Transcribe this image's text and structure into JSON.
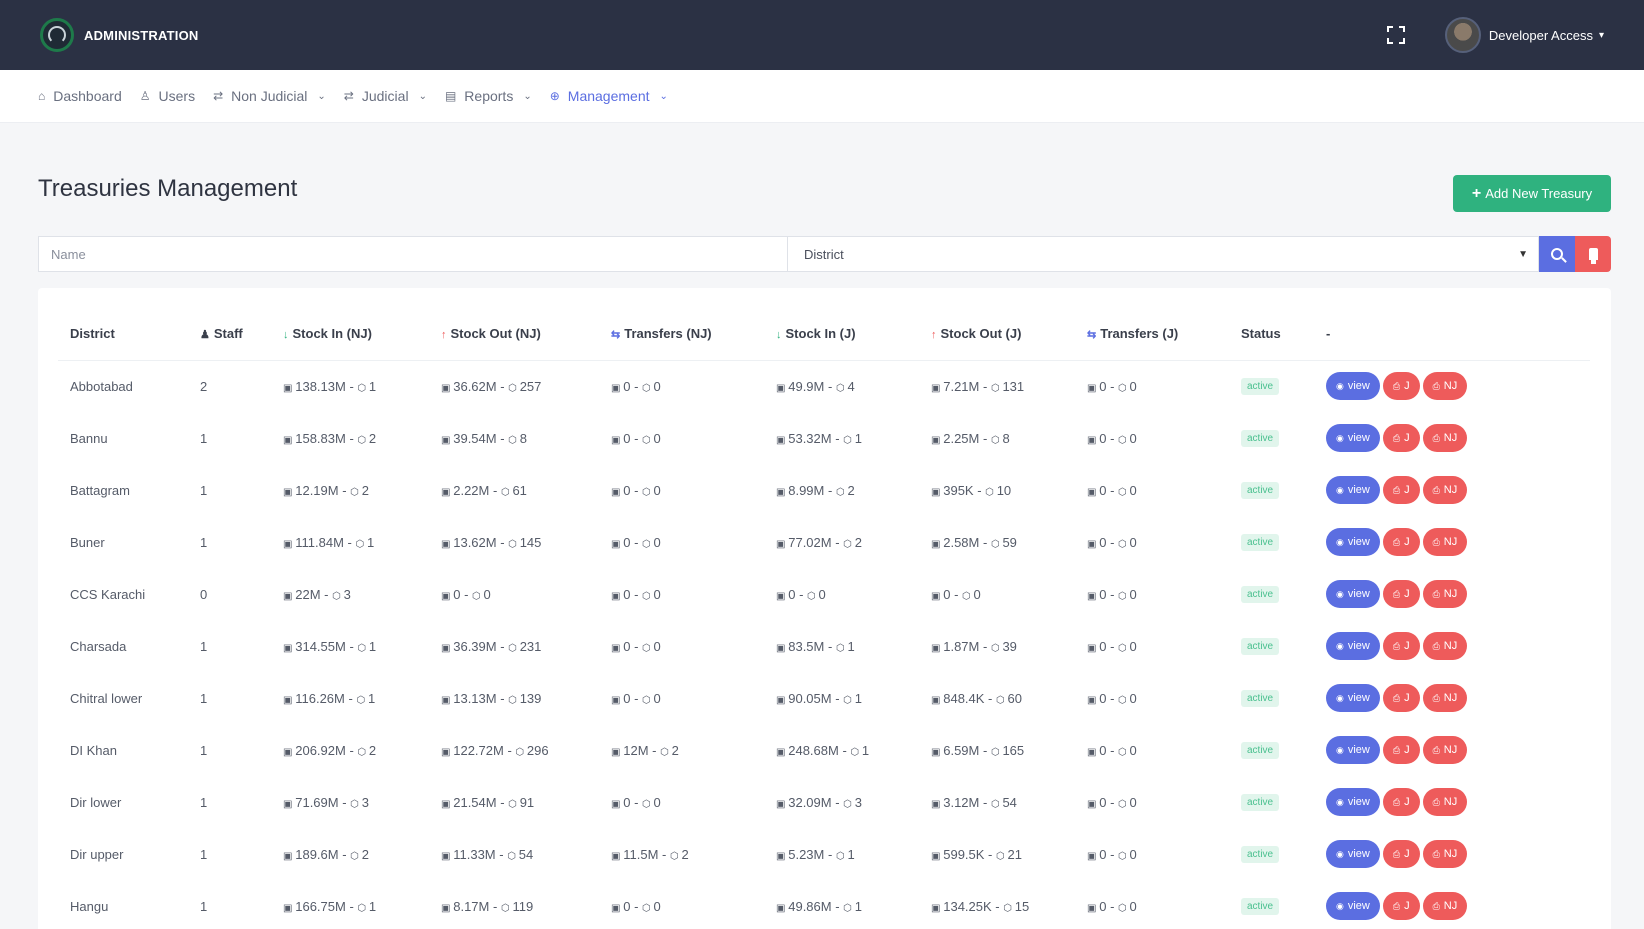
{
  "header": {
    "brand": "ADMINISTRATION",
    "user_name": "Developer Access"
  },
  "nav": [
    {
      "label": "Dashboard",
      "icon": "home-icon",
      "glyph": "⌂",
      "dropdown": false,
      "active": false
    },
    {
      "label": "Users",
      "icon": "user-icon",
      "glyph": "♙",
      "dropdown": false,
      "active": false
    },
    {
      "label": "Non Judicial",
      "icon": "swap-icon",
      "glyph": "⇄",
      "dropdown": true,
      "active": false
    },
    {
      "label": "Judicial",
      "icon": "swap-icon",
      "glyph": "⇄",
      "dropdown": true,
      "active": false
    },
    {
      "label": "Reports",
      "icon": "report-icon",
      "glyph": "▤",
      "dropdown": true,
      "active": false
    },
    {
      "label": "Management",
      "icon": "globe-icon",
      "glyph": "⊕",
      "dropdown": true,
      "active": true
    }
  ],
  "page": {
    "title": "Treasuries Management",
    "add_button": "Add New Treasury",
    "name_placeholder": "Name",
    "district_select": "District"
  },
  "table": {
    "headers": [
      "District",
      "Staff",
      "Stock In (NJ)",
      "Stock Out (NJ)",
      "Transfers (NJ)",
      "Stock In (J)",
      "Stock Out (J)",
      "Transfers (J)",
      "Status",
      "-"
    ],
    "action_labels": {
      "view": "view",
      "j": "J",
      "nj": "NJ"
    },
    "rows": [
      {
        "district": "Abbotabad",
        "staff": "2",
        "cells": [
          [
            "138.13M",
            "1"
          ],
          [
            "36.62M",
            "257"
          ],
          [
            "0",
            "0"
          ],
          [
            "49.9M",
            "4"
          ],
          [
            "7.21M",
            "131"
          ],
          [
            "0",
            "0"
          ]
        ],
        "status": "active"
      },
      {
        "district": "Bannu",
        "staff": "1",
        "cells": [
          [
            "158.83M",
            "2"
          ],
          [
            "39.54M",
            "8"
          ],
          [
            "0",
            "0"
          ],
          [
            "53.32M",
            "1"
          ],
          [
            "2.25M",
            "8"
          ],
          [
            "0",
            "0"
          ]
        ],
        "status": "active"
      },
      {
        "district": "Battagram",
        "staff": "1",
        "cells": [
          [
            "12.19M",
            "2"
          ],
          [
            "2.22M",
            "61"
          ],
          [
            "0",
            "0"
          ],
          [
            "8.99M",
            "2"
          ],
          [
            "395K",
            "10"
          ],
          [
            "0",
            "0"
          ]
        ],
        "status": "active"
      },
      {
        "district": "Buner",
        "staff": "1",
        "cells": [
          [
            "111.84M",
            "1"
          ],
          [
            "13.62M",
            "145"
          ],
          [
            "0",
            "0"
          ],
          [
            "77.02M",
            "2"
          ],
          [
            "2.58M",
            "59"
          ],
          [
            "0",
            "0"
          ]
        ],
        "status": "active"
      },
      {
        "district": "CCS Karachi",
        "staff": "0",
        "cells": [
          [
            "22M",
            "3"
          ],
          [
            "0",
            "0"
          ],
          [
            "0",
            "0"
          ],
          [
            "0",
            "0"
          ],
          [
            "0",
            "0"
          ],
          [
            "0",
            "0"
          ]
        ],
        "status": "active"
      },
      {
        "district": "Charsada",
        "staff": "1",
        "cells": [
          [
            "314.55M",
            "1"
          ],
          [
            "36.39M",
            "231"
          ],
          [
            "0",
            "0"
          ],
          [
            "83.5M",
            "1"
          ],
          [
            "1.87M",
            "39"
          ],
          [
            "0",
            "0"
          ]
        ],
        "status": "active"
      },
      {
        "district": "Chitral lower",
        "staff": "1",
        "cells": [
          [
            "116.26M",
            "1"
          ],
          [
            "13.13M",
            "139"
          ],
          [
            "0",
            "0"
          ],
          [
            "90.05M",
            "1"
          ],
          [
            "848.4K",
            "60"
          ],
          [
            "0",
            "0"
          ]
        ],
        "status": "active"
      },
      {
        "district": "DI Khan",
        "staff": "1",
        "cells": [
          [
            "206.92M",
            "2"
          ],
          [
            "122.72M",
            "296"
          ],
          [
            "12M",
            "2"
          ],
          [
            "248.68M",
            "1"
          ],
          [
            "6.59M",
            "165"
          ],
          [
            "0",
            "0"
          ]
        ],
        "status": "active"
      },
      {
        "district": "Dir lower",
        "staff": "1",
        "cells": [
          [
            "71.69M",
            "3"
          ],
          [
            "21.54M",
            "91"
          ],
          [
            "0",
            "0"
          ],
          [
            "32.09M",
            "3"
          ],
          [
            "3.12M",
            "54"
          ],
          [
            "0",
            "0"
          ]
        ],
        "status": "active"
      },
      {
        "district": "Dir upper",
        "staff": "1",
        "cells": [
          [
            "189.6M",
            "2"
          ],
          [
            "11.33M",
            "54"
          ],
          [
            "11.5M",
            "2"
          ],
          [
            "5.23M",
            "1"
          ],
          [
            "599.5K",
            "21"
          ],
          [
            "0",
            "0"
          ]
        ],
        "status": "active"
      },
      {
        "district": "Hangu",
        "staff": "1",
        "cells": [
          [
            "166.75M",
            "1"
          ],
          [
            "8.17M",
            "119"
          ],
          [
            "0",
            "0"
          ],
          [
            "49.86M",
            "1"
          ],
          [
            "134.25K",
            "15"
          ],
          [
            "0",
            "0"
          ]
        ],
        "status": "active"
      }
    ]
  },
  "colors": {
    "topbar": "#2b3144",
    "accent": "#5b6ee1",
    "success": "#2fb27f",
    "danger": "#ee5b5b"
  }
}
